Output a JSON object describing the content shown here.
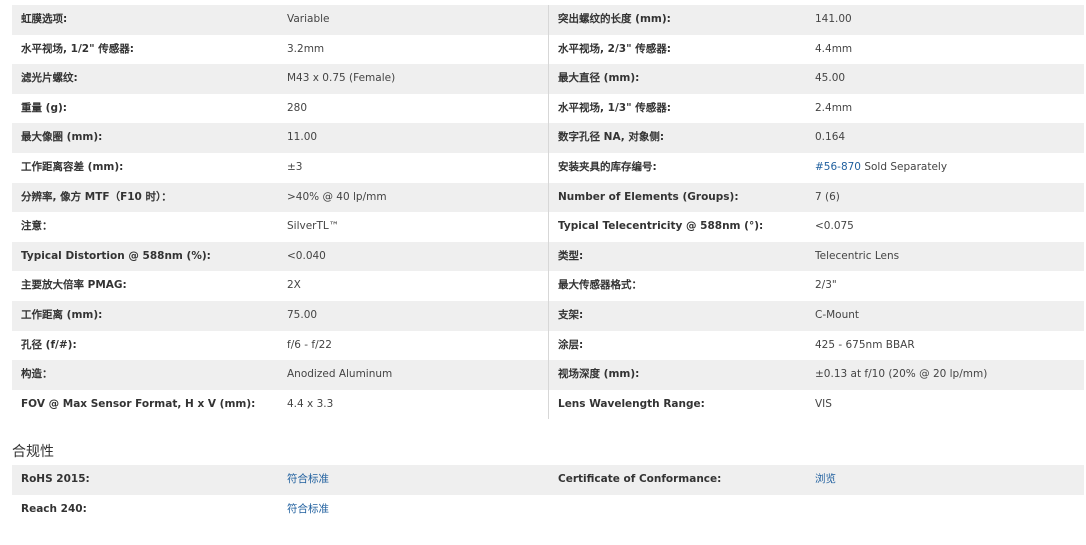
{
  "specs": {
    "rows": [
      {
        "l1": "虹膜选项:",
        "v1": "Variable",
        "l2": "突出螺纹的长度 (mm):",
        "v2": "141.00"
      },
      {
        "l1": "水平视场, 1/2\" 传感器:",
        "v1": "3.2mm",
        "l2": "水平视场, 2/3\" 传感器:",
        "v2": "4.4mm"
      },
      {
        "l1": "滤光片螺纹:",
        "v1": "M43 x 0.75 (Female)",
        "l2": "最大直径 (mm):",
        "v2": "45.00"
      },
      {
        "l1": "重量 (g):",
        "v1": "280",
        "l2": "水平视场, 1/3\" 传感器:",
        "v2": "2.4mm"
      },
      {
        "l1": "最大像圈 (mm):",
        "v1": "11.00",
        "l2": "数字孔径 NA, 对象侧:",
        "v2": "0.164"
      },
      {
        "l1": "工作距离容差 (mm):",
        "v1": "±3",
        "l2": "安装夹具的库存编号:",
        "v2_link": "#56-870",
        "v2": " Sold Separately"
      },
      {
        "l1": "分辨率, 像方 MTF（F10 时）：",
        "v1": ">40% @ 40 lp/mm",
        "l2": "Number of Elements (Groups):",
        "v2": "7 (6)"
      },
      {
        "l1": "注意：",
        "v1": "SilverTL™",
        "l2": "Typical Telecentricity @ 588nm (°):",
        "v2": "<0.075"
      },
      {
        "l1": "Typical Distortion @ 588nm (%):",
        "v1": "<0.040",
        "l2": "类型:",
        "v2": "Telecentric Lens"
      },
      {
        "l1": "主要放大倍率 PMAG:",
        "v1": "2X",
        "l2": "最大传感器格式：",
        "v2": "2/3\""
      },
      {
        "l1": "工作距离 (mm):",
        "v1": "75.00",
        "l2": "支架:",
        "v2": "C-Mount"
      },
      {
        "l1": "孔径 (f/#):",
        "v1": "f/6 - f/22",
        "l2": "涂层:",
        "v2": "425 - 675nm BBAR"
      },
      {
        "l1": "构造：",
        "v1": "Anodized Aluminum",
        "l2": "视场深度 (mm):",
        "v2": "±0.13 at f/10 (20% @ 20 lp/mm)"
      },
      {
        "l1": "FOV @ Max Sensor Format, H x V (mm):",
        "v1": "4.4 x 3.3",
        "l2": "Lens Wavelength Range:",
        "v2": "VIS"
      }
    ]
  },
  "compliance": {
    "title": "合规性",
    "rows": [
      {
        "l1": "RoHS 2015:",
        "v1": "符合标准",
        "l2": "Certificate of Conformance:",
        "v2": "浏览"
      },
      {
        "l1": "Reach 240:",
        "v1": "符合标准",
        "l2": "",
        "v2": ""
      }
    ]
  }
}
